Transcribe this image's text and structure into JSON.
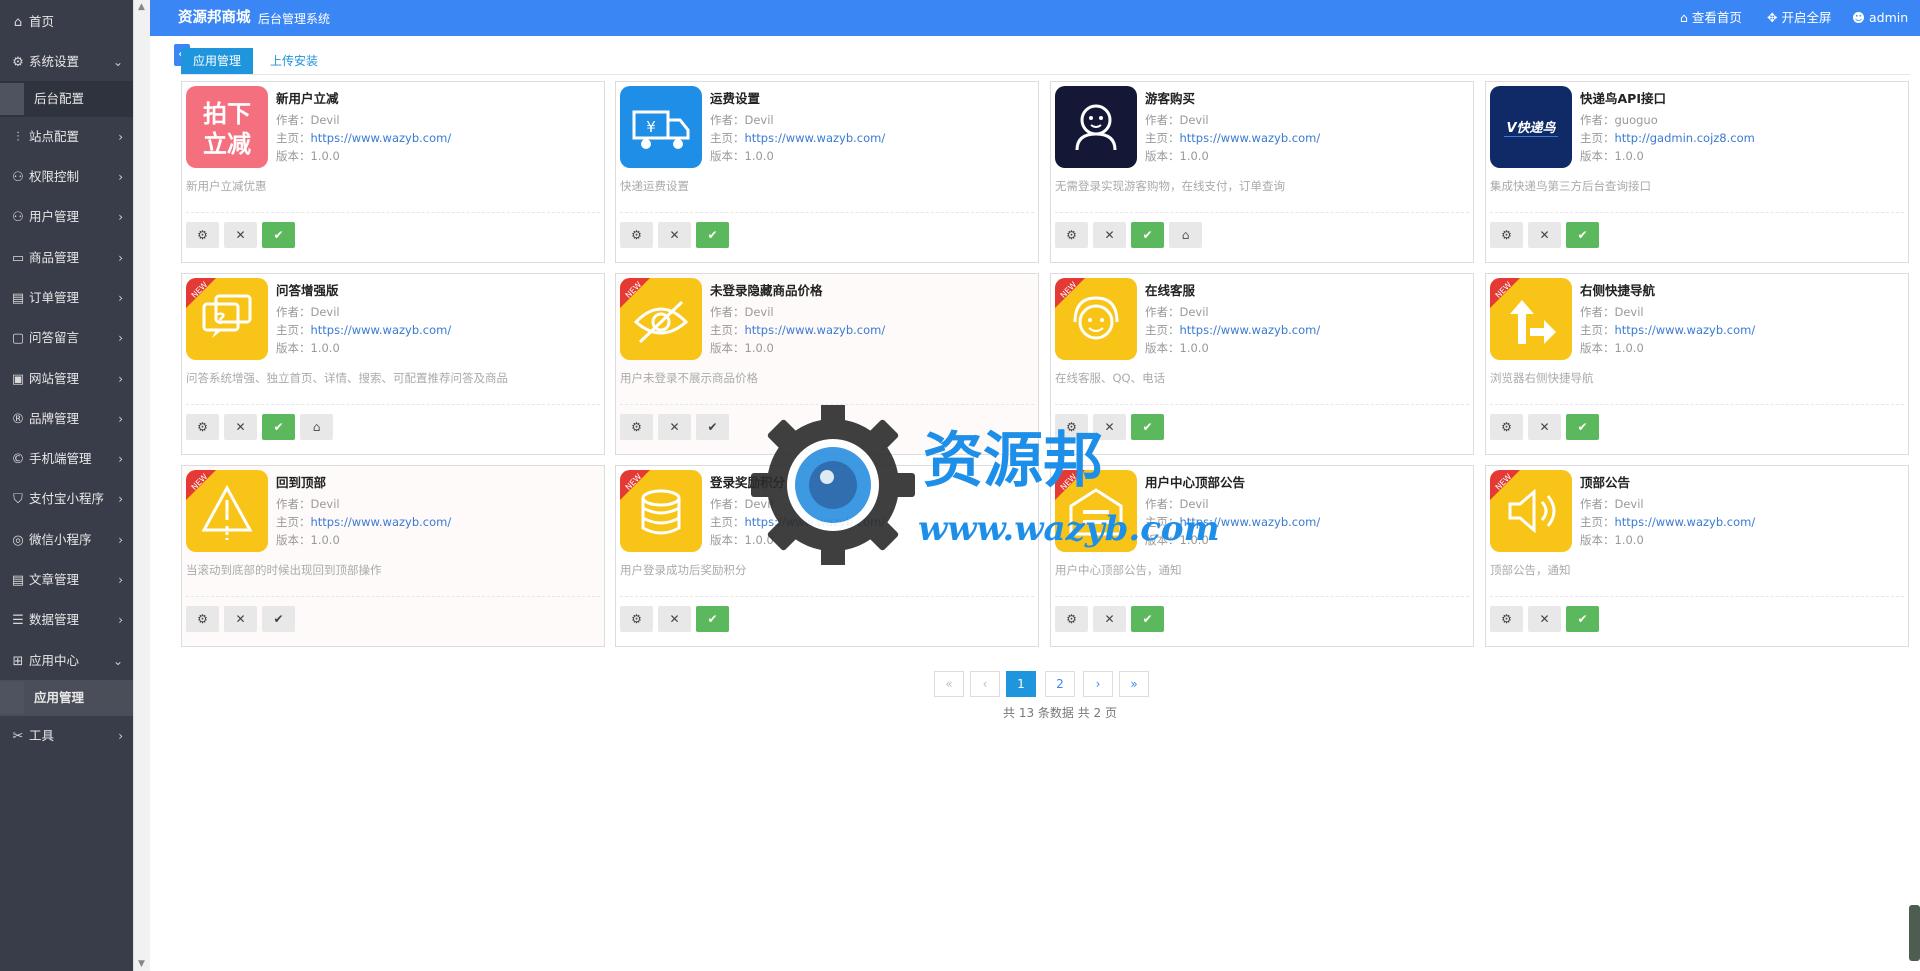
{
  "sidebar": {
    "items": [
      {
        "label": "首页",
        "icon": "home-icon",
        "glyph": "⌂",
        "chevron": ""
      },
      {
        "label": "系统设置",
        "icon": "gear-icon",
        "glyph": "⚙",
        "chevron": "⌄"
      },
      {
        "label": "站点配置",
        "icon": "sliders-icon",
        "glyph": "⫶",
        "chevron": "›"
      },
      {
        "label": "权限控制",
        "icon": "user-icon",
        "glyph": "⚇",
        "chevron": "›"
      },
      {
        "label": "用户管理",
        "icon": "users-icon",
        "glyph": "⚇",
        "chevron": "›"
      },
      {
        "label": "商品管理",
        "icon": "box-icon",
        "glyph": "▭",
        "chevron": "›"
      },
      {
        "label": "订单管理",
        "icon": "list-icon",
        "glyph": "▤",
        "chevron": "›"
      },
      {
        "label": "问答留言",
        "icon": "chat-icon",
        "glyph": "▢",
        "chevron": "›"
      },
      {
        "label": "网站管理",
        "icon": "window-icon",
        "glyph": "▣",
        "chevron": "›"
      },
      {
        "label": "品牌管理",
        "icon": "registered-icon",
        "glyph": "®",
        "chevron": "›"
      },
      {
        "label": "手机端管理",
        "icon": "copyright-icon",
        "glyph": "©",
        "chevron": "›"
      },
      {
        "label": "支付宝小程序",
        "icon": "shield-icon",
        "glyph": "⛉",
        "chevron": "›"
      },
      {
        "label": "微信小程序",
        "icon": "wechat-icon",
        "glyph": "◎",
        "chevron": "›"
      },
      {
        "label": "文章管理",
        "icon": "file-icon",
        "glyph": "▤",
        "chevron": "›"
      },
      {
        "label": "数据管理",
        "icon": "database-icon",
        "glyph": "☰",
        "chevron": "›"
      },
      {
        "label": "应用中心",
        "icon": "apps-icon",
        "glyph": "⊞",
        "chevron": "⌄"
      },
      {
        "label": "工具",
        "icon": "tools-icon",
        "glyph": "✂",
        "chevron": "›"
      }
    ],
    "sub_backend": "后台配置",
    "sub_apps": "应用管理"
  },
  "header": {
    "brand": "资源邦商城",
    "subtitle": "后台管理系统",
    "view_home": "查看首页",
    "fullscreen": "开启全屏",
    "user": "admin"
  },
  "tabs": {
    "active": "应用管理",
    "upload": "上传安装"
  },
  "labels": {
    "author": "作者：",
    "homepage": "主页：",
    "version": "版本："
  },
  "cards": [
    {
      "title": "新用户立减",
      "author": "Devil",
      "url": "https://www.wazyb.com/",
      "version": "1.0.0",
      "desc": "新用户立减优惠",
      "icon": "new-user-discount-icon",
      "home_btn": false,
      "enabled": true
    },
    {
      "title": "运费设置",
      "author": "Devil",
      "url": "https://www.wazyb.com/",
      "version": "1.0.0",
      "desc": "快递运费设置",
      "icon": "delivery-truck-icon",
      "home_btn": false,
      "enabled": true
    },
    {
      "title": "游客购买",
      "author": "Devil",
      "url": "https://www.wazyb.com/",
      "version": "1.0.0",
      "desc": "无需登录实现游客购物，在线支付，订单查询",
      "icon": "guest-user-icon",
      "home_btn": true,
      "enabled": true
    },
    {
      "title": "快递鸟API接口",
      "author": "guoguo",
      "url": "http://gadmin.cojz8.com",
      "version": "1.0.0",
      "desc": "集成快递鸟第三方后台查询接口",
      "icon": "kdniao-logo-icon",
      "home_btn": false,
      "enabled": true
    },
    {
      "title": "问答增强版",
      "author": "Devil",
      "url": "https://www.wazyb.com/",
      "version": "1.0.0",
      "desc": "问答系统增强、独立首页、详情、搜索、可配置推荐问答及商品",
      "icon": "qa-icon",
      "home_btn": true,
      "enabled": true
    },
    {
      "title": "未登录隐藏商品价格",
      "author": "Devil",
      "url": "https://www.wazyb.com/",
      "version": "1.0.0",
      "desc": "用户未登录不展示商品价格",
      "icon": "eye-hidden-icon",
      "home_btn": false,
      "enabled": false
    },
    {
      "title": "在线客服",
      "author": "Devil",
      "url": "https://www.wazyb.com/",
      "version": "1.0.0",
      "desc": "在线客服、QQ、电话",
      "icon": "customer-service-icon",
      "home_btn": false,
      "enabled": true
    },
    {
      "title": "右侧快捷导航",
      "author": "Devil",
      "url": "https://www.wazyb.com/",
      "version": "1.0.0",
      "desc": "浏览器右侧快捷导航",
      "icon": "shortcut-arrow-icon",
      "home_btn": false,
      "enabled": true
    },
    {
      "title": "回到顶部",
      "author": "Devil",
      "url": "https://www.wazyb.com/",
      "version": "1.0.0",
      "desc": "当滚动到底部的时候出现回到顶部操作",
      "icon": "back-to-top-icon",
      "home_btn": false,
      "enabled": false
    },
    {
      "title": "登录奖励积分",
      "author": "Devil",
      "url": "https://www.wazyb.com/",
      "version": "1.0.0",
      "desc": "用户登录成功后奖励积分",
      "icon": "coins-icon",
      "home_btn": false,
      "enabled": true
    },
    {
      "title": "用户中心顶部公告",
      "author": "Devil",
      "url": "https://www.wazyb.com/",
      "version": "1.0.0",
      "desc": "用户中心顶部公告，通知",
      "icon": "notice-icon",
      "home_btn": false,
      "enabled": true
    },
    {
      "title": "顶部公告",
      "author": "Devil",
      "url": "https://www.wazyb.com/",
      "version": "1.0.0",
      "desc": "顶部公告，通知",
      "icon": "speaker-icon",
      "home_btn": false,
      "enabled": true
    }
  ],
  "pagination": {
    "first": "«",
    "prev": "‹",
    "pages": [
      "1",
      "2"
    ],
    "next": "›",
    "last": "»",
    "summary": "共 13 条数据   共 2 页"
  },
  "watermark": {
    "text": "资源邦",
    "url": "www.wazyb.com"
  },
  "colors": {
    "accent": "#3a86f5",
    "sidebar": "#393d49",
    "success": "#5cb85c",
    "primary": "#1e95dc"
  }
}
